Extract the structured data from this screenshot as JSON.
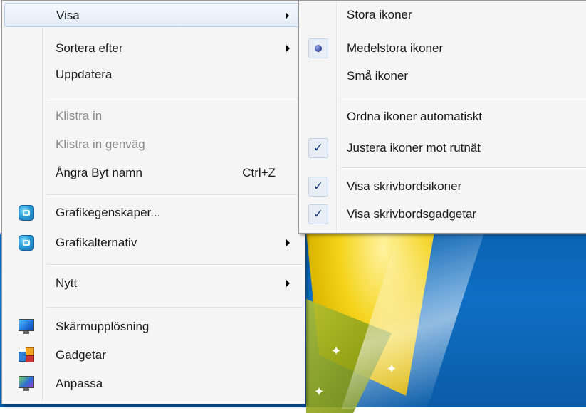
{
  "main_menu": {
    "items": [
      {
        "label": "Visa",
        "submenu": true,
        "hover": true
      },
      {
        "label": "Sortera efter",
        "submenu": true
      },
      {
        "label": "Uppdatera"
      },
      {
        "label": "Klistra in",
        "disabled": true
      },
      {
        "label": "Klistra in genväg",
        "disabled": true
      },
      {
        "label": "Ångra Byt namn",
        "shortcut": "Ctrl+Z"
      },
      {
        "label": "Grafikegenskaper...",
        "icon": "graphics-properties-icon"
      },
      {
        "label": "Grafikalternativ",
        "icon": "graphics-options-icon",
        "submenu": true
      },
      {
        "label": "Nytt",
        "submenu": true
      },
      {
        "label": "Skärmupplösning",
        "icon": "screen-resolution-icon"
      },
      {
        "label": "Gadgetar",
        "icon": "gadgets-icon"
      },
      {
        "label": "Anpassa",
        "icon": "personalize-icon"
      }
    ]
  },
  "view_submenu": {
    "items": [
      {
        "label": "Stora ikoner"
      },
      {
        "label": "Medelstora ikoner",
        "radio": true
      },
      {
        "label": "Små ikoner"
      },
      {
        "label": "Ordna ikoner automatiskt"
      },
      {
        "label": "Justera ikoner mot rutnät",
        "checked": true
      },
      {
        "label": "Visa skrivbordsikoner",
        "checked": true
      },
      {
        "label": "Visa skrivbordsgadgetar",
        "checked": true
      }
    ]
  },
  "glyphs": {
    "check": "✓",
    "sparkle": "✦"
  }
}
